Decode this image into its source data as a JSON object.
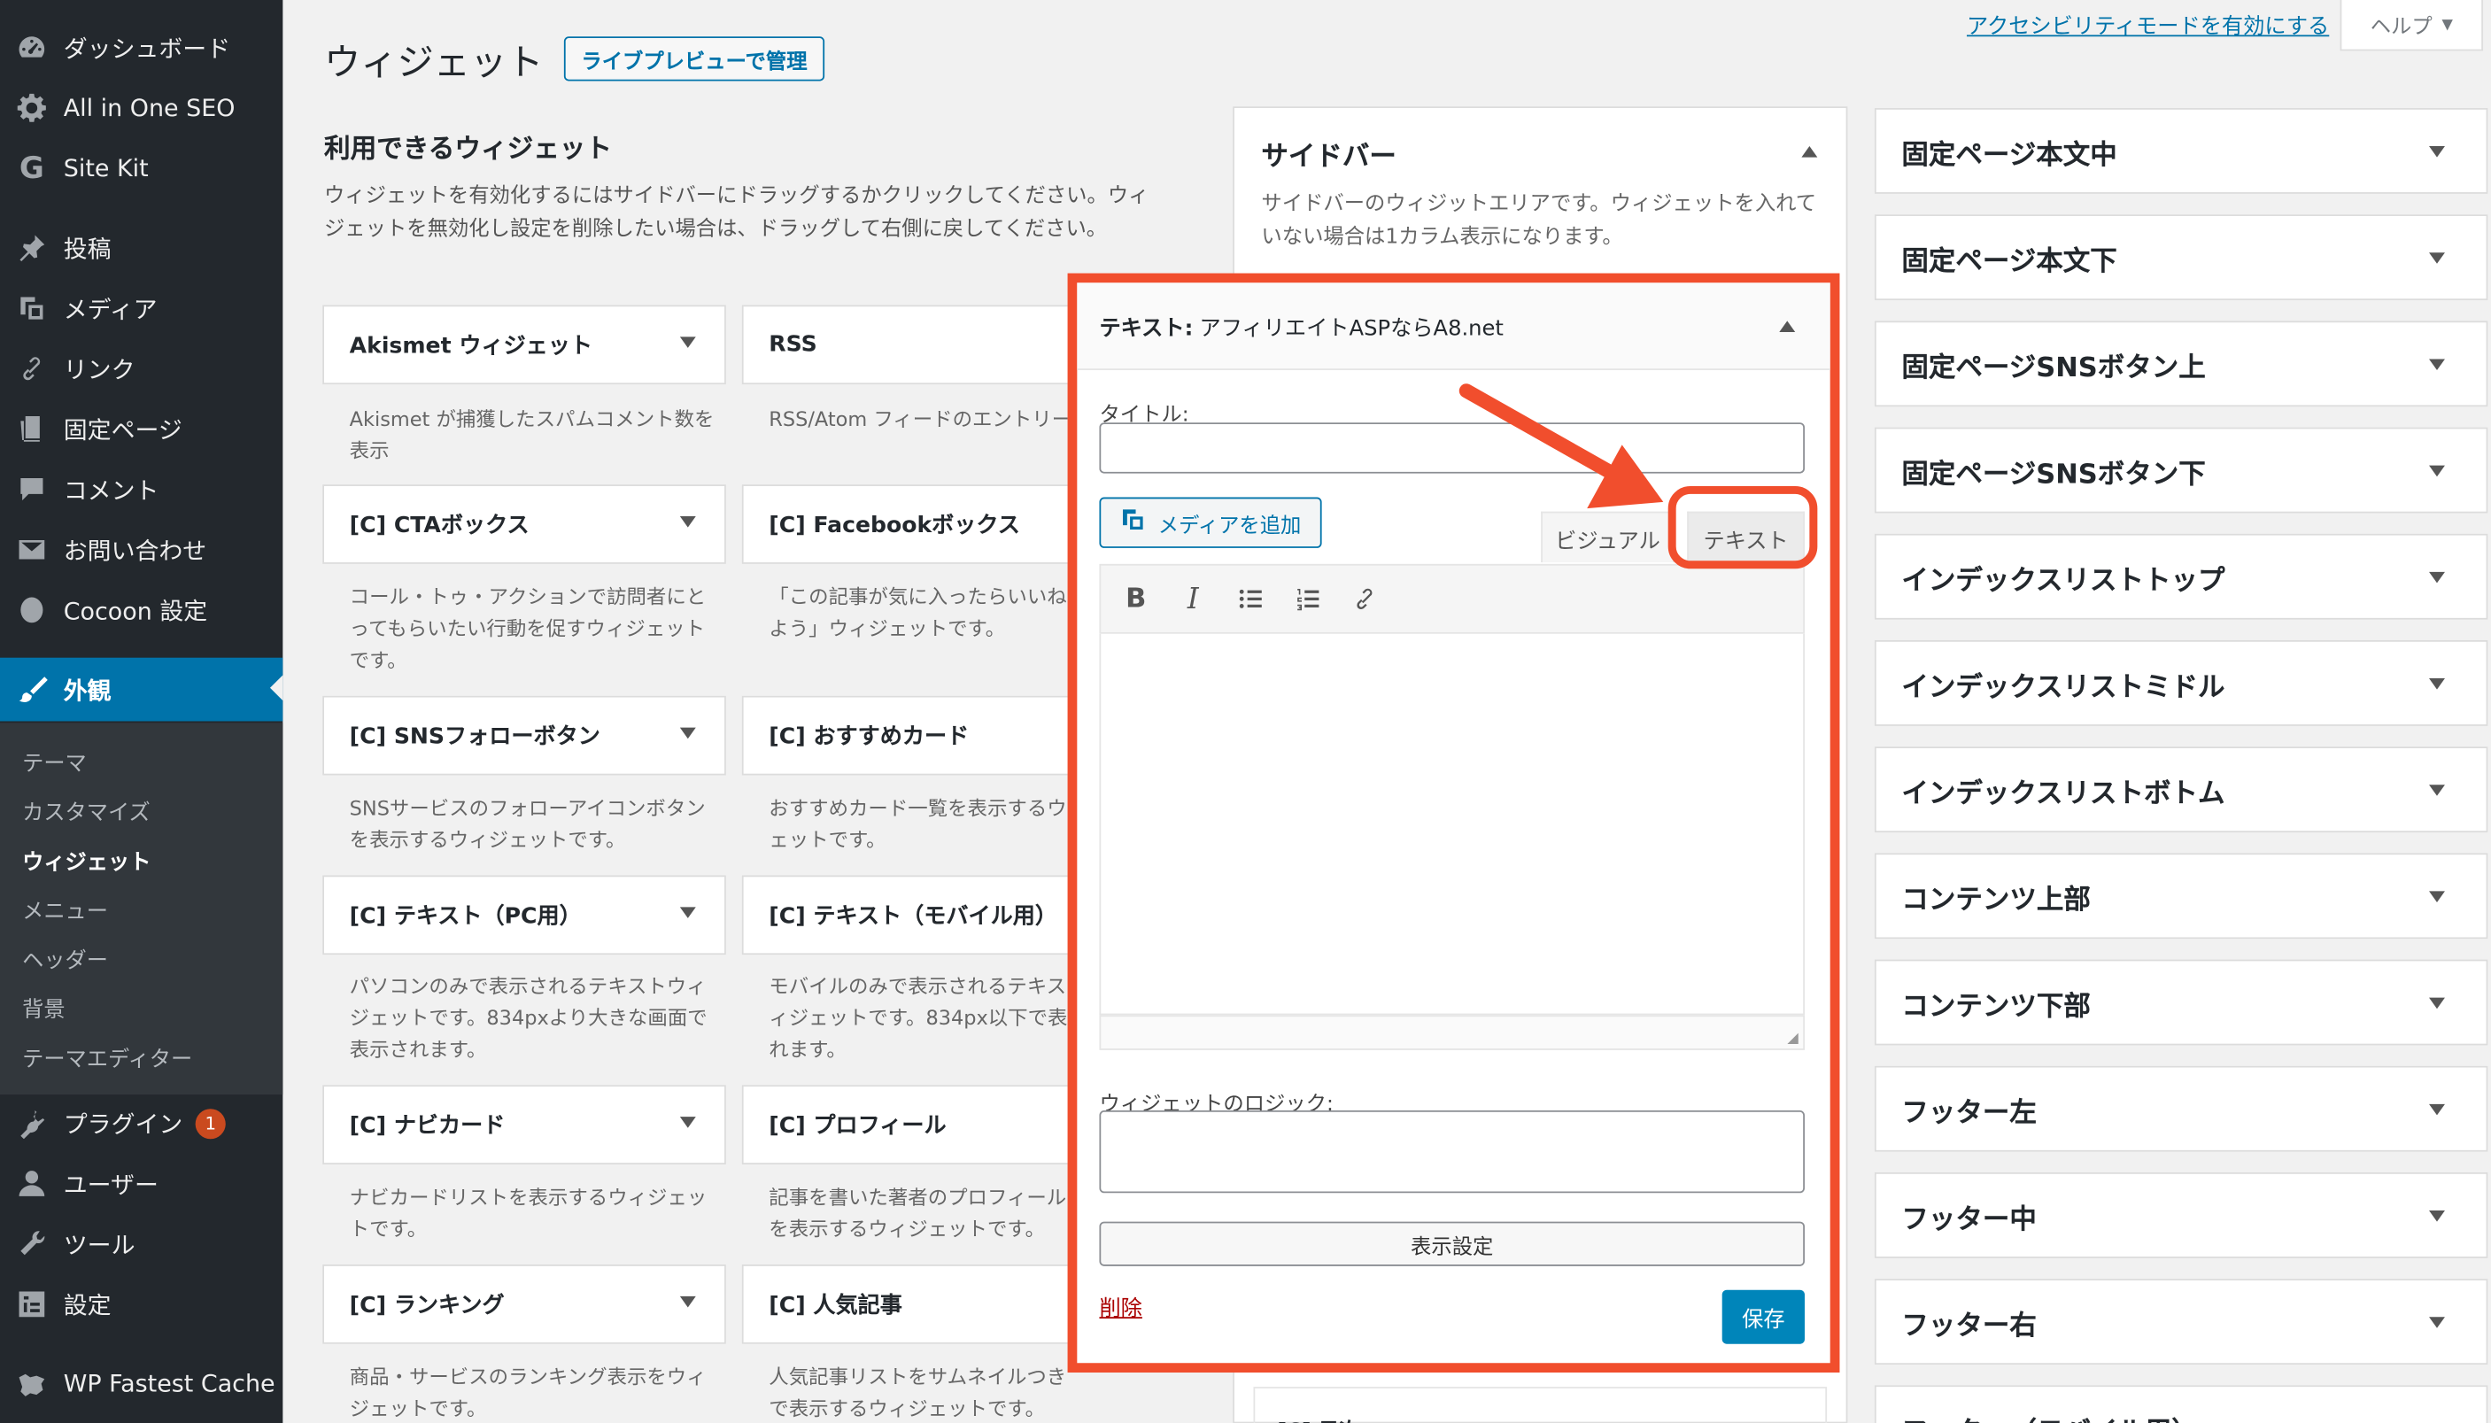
{
  "menu": {
    "dashboard": "ダッシュボード",
    "aioseo": "All in One SEO",
    "sitekit": "Site Kit",
    "posts": "投稿",
    "media": "メディア",
    "links": "リンク",
    "pages": "固定ページ",
    "comments": "コメント",
    "contact": "お問い合わせ",
    "cocoon": "Cocoon 設定",
    "appearance": "外観",
    "submenu": [
      "テーマ",
      "カスタマイズ",
      "ウィジェット",
      "メニュー",
      "ヘッダー",
      "背景",
      "テーマエディター"
    ],
    "plugins": "プラグイン",
    "plugins_badge": "1",
    "users": "ユーザー",
    "tools": "ツール",
    "settings": "設定",
    "wpfc": "WP Fastest Cache"
  },
  "header": {
    "title": "ウィジェット",
    "live_preview": "ライブプレビューで管理",
    "a11y": "アクセシビリティモードを有効にする",
    "help": "ヘルプ"
  },
  "available": {
    "title": "利用できるウィジェット",
    "desc": "ウィジェットを有効化するにはサイドバーにドラッグするかクリックしてください。ウィジェットを無効化し設定を削除したい場合は、ドラッグして右側に戻してください。",
    "widgets": [
      {
        "name": "Akismet ウィジェット",
        "desc": "Akismet が捕獲したスパムコメント数を表示"
      },
      {
        "name": "RSS",
        "desc": "RSS/Atom フィードのエントリー"
      },
      {
        "name": "[C] CTAボックス",
        "desc": "コール・トゥ・アクションで訪問者にとってもらいたい行動を促すウィジェットです。"
      },
      {
        "name": "[C] Facebookボックス",
        "desc": "「この記事が気に入ったらいいねよう」ウィジェットです。"
      },
      {
        "name": "[C] SNSフォローボタン",
        "desc": "SNSサービスのフォローアイコンボタンを表示するウィジェットです。"
      },
      {
        "name": "[C] おすすめカード",
        "desc": "おすすめカード一覧を表示するウェットです。"
      },
      {
        "name": "[C] テキスト（PC用）",
        "desc": "パソコンのみで表示されるテキストウィジェットです。834pxより大きな画面で表示されます。"
      },
      {
        "name": "[C] テキスト（モバイル用）",
        "desc": "モバイルのみで表示されるテキスィジェットです。834px以下で表れます。"
      },
      {
        "name": "[C] ナビカード",
        "desc": "ナビカードリストを表示するウィジェットです。"
      },
      {
        "name": "[C] プロフィール",
        "desc": "記事を書いた著者のプロフィールを表示するウィジェットです。"
      },
      {
        "name": "[C] ランキング",
        "desc": "商品・サービスのランキング表示をウィジェットです。"
      },
      {
        "name": "[C] 人気記事",
        "desc": "人気記事リストをサムネイルつきで表示するウィジェットです。"
      }
    ]
  },
  "sidebar": {
    "title": "サイドバー",
    "desc": "サイドバーのウィジットエリアです。ウィジェットを入れていない場合は1カラム表示になります。",
    "next_widget": "[C] 目次"
  },
  "text_widget": {
    "header_prefix": "テキスト:",
    "header_name": "アフィリエイトASPならA8.net",
    "title_label": "タイトル:",
    "title_value": "",
    "add_media": "メディアを追加",
    "tab_visual": "ビジュアル",
    "tab_text": "テキスト",
    "logic_label": "ウィジェットのロジック:",
    "display_settings": "表示設定",
    "delete": "削除",
    "save": "保存"
  },
  "areas": [
    "固定ページ本文中",
    "固定ページ本文下",
    "固定ページSNSボタン上",
    "固定ページSNSボタン下",
    "インデックスリストトップ",
    "インデックスリストミドル",
    "インデックスリストボトム",
    "コンテンツ上部",
    "コンテンツ下部",
    "フッター左",
    "フッター中",
    "フッター右",
    "フッター（モバイル用）"
  ],
  "colors": {
    "accent": "#0073aa",
    "highlight": "#f14e2d",
    "menu_bg": "#23282d"
  }
}
